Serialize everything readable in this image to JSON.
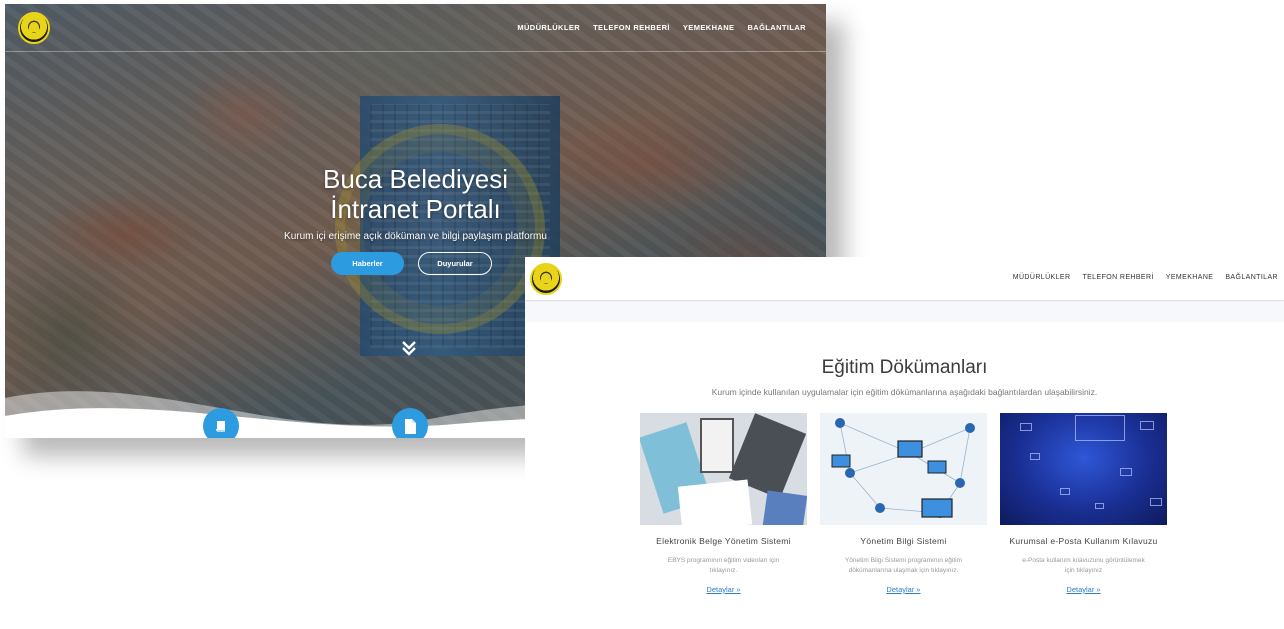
{
  "hero": {
    "nav": [
      "MÜDÜRLÜKLER",
      "TELEFON REHBERİ",
      "YEMEKHANE",
      "BAĞLANTILAR"
    ],
    "title_line1": "Buca Belediyesi",
    "title_line2": "İntranet Portalı",
    "subtitle": "Kurum içi erişime açık döküman ve bilgi paylaşım platformu",
    "btn_news": "Haberler",
    "btn_announcements": "Duyurular",
    "scroll_icon": "double-chevron-down-icon",
    "feature_icons": [
      "book-icon",
      "document-icon"
    ],
    "accent": "#2d9be0"
  },
  "docs": {
    "nav": [
      "MÜDÜRLÜKLER",
      "TELEFON REHBERİ",
      "YEMEKHANE",
      "BAĞLANTILAR"
    ],
    "heading": "Eğitim Dökümanları",
    "description": "Kurum içinde kullanılan uygulamalar için eğitim dökümanlarına aşağıdaki bağlantılardan ulaşabilirsiniz.",
    "cards": [
      {
        "title": "Elektronik Belge Yönetim Sistemi",
        "text": "EBYS programının eğitim videoları için tıklayınız.",
        "link": "Detaylar »"
      },
      {
        "title": "Yönetim Bilgi Sistemi",
        "text": "Yönetim Bilgi Sistemi programının eğitim dökümanlarına ulaşmak için tıklayınız.",
        "link": "Detaylar »"
      },
      {
        "title": "Kurumsal e-Posta Kullanım Kılavuzu",
        "text": "e-Posta kullanım kılavuzunu görüntülemek için tıklayınız",
        "link": "Detaylar »"
      }
    ]
  }
}
